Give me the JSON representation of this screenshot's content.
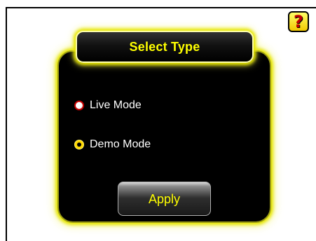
{
  "header": {
    "help_label": "?",
    "help_icon": "question-mark-icon"
  },
  "dialog": {
    "title": "Select Type",
    "options": [
      {
        "label": "Live Mode",
        "selected": false
      },
      {
        "label": "Demo Mode",
        "selected": true
      }
    ],
    "apply_label": "Apply"
  },
  "colors": {
    "accent": "#ffff00",
    "dialog_background": "#000000",
    "glow": "#e6e600",
    "help_button": "#f2c800",
    "help_glyph": "#c00000"
  }
}
